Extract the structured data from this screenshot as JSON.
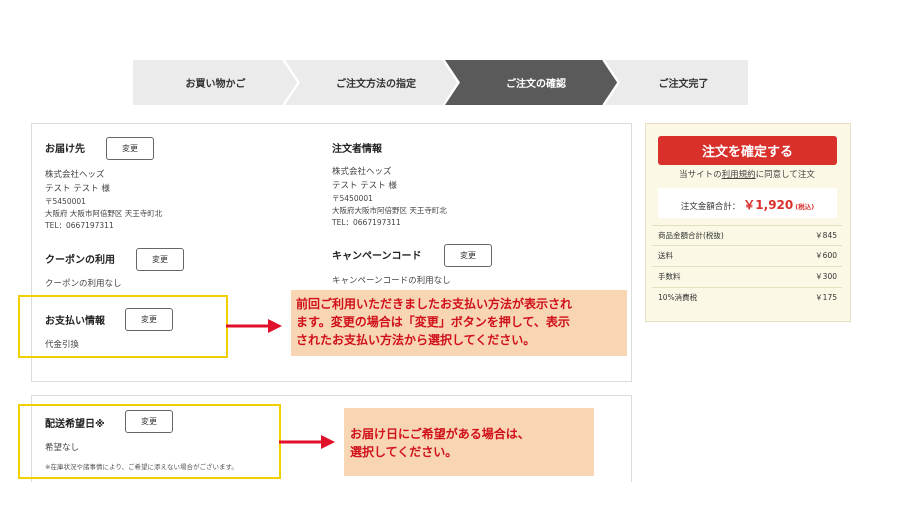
{
  "steps": [
    {
      "label": "お買い物かご",
      "active": false
    },
    {
      "label": "ご注文方法の指定",
      "active": false
    },
    {
      "label": "ご注文の確認",
      "active": true
    },
    {
      "label": "ご注文完了",
      "active": false
    }
  ],
  "delivery": {
    "title": "お届け先",
    "change": "変更",
    "company": "株式会社ヘッズ",
    "name": "テスト テスト 様",
    "zip": "〒5450001",
    "address": "大阪府 大阪市阿倍野区 天王寺町北",
    "tel": "TEL：0667197311"
  },
  "orderer": {
    "title": "注文者情報",
    "company": "株式会社ヘッズ",
    "name": "テスト テスト 様",
    "zip": "〒5450001",
    "address": "大阪府大阪市阿倍野区 天王寺町北",
    "tel": "TEL：0667197311"
  },
  "coupon": {
    "title": "クーポンの利用",
    "change": "変更",
    "value": "クーポンの利用なし"
  },
  "campaign": {
    "title": "キャンペーンコード",
    "change": "変更",
    "value": "キャンペーンコードの利用なし"
  },
  "payment": {
    "title": "お支払い情報",
    "change": "変更",
    "value": "代金引換"
  },
  "shipping_date": {
    "title": "配送希望日※",
    "change": "変更",
    "value": "希望なし",
    "note": "※在庫状況や諸事情により、ご希望に添えない場合がございます。"
  },
  "callout1": {
    "line1": "前回ご利用いただきましたお支払い方法が表示され",
    "line2": "ます。変更の場合は「変更」ボタンを押して、表示",
    "line3": "されたお支払い方法から選択してください。"
  },
  "callout2": {
    "line1": "お届け日にご希望がある場合は、",
    "line2": "選択してください。"
  },
  "summary": {
    "confirm_button": "注文を確定する",
    "terms_pre": "当サイトの",
    "terms_link": "利用規約",
    "terms_post": "に同意して注文",
    "total_label": "注文金額合計：",
    "total_value": "￥1,920",
    "total_tax": "(税込)",
    "rows": [
      {
        "label": "商品金額合計(税抜)",
        "value": "￥845"
      },
      {
        "label": "送料",
        "value": "￥600"
      },
      {
        "label": "手数料",
        "value": "￥300"
      },
      {
        "label": "10%消費税",
        "value": "￥175"
      }
    ]
  },
  "colors": {
    "accent_red": "#d9302c",
    "highlight_yellow": "#f0d000",
    "callout_bg": "#f8d6b4",
    "callout_text": "#d0101a",
    "step_active": "#5a5a5a",
    "step_inactive": "#ebebeb"
  }
}
